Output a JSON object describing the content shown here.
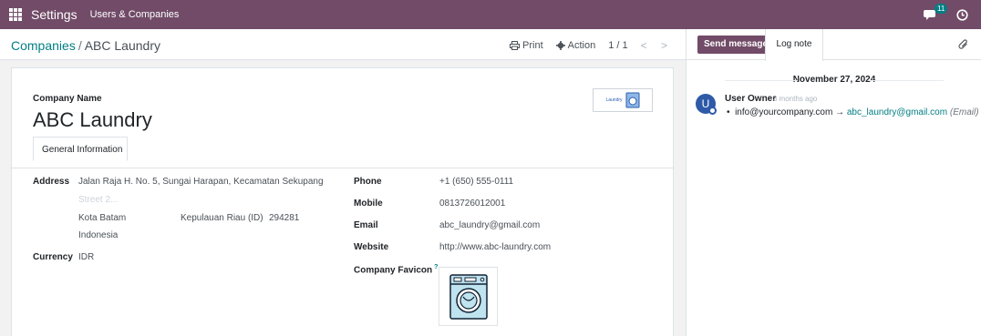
{
  "navbar": {
    "app_title": "Settings",
    "menu_users": "Users & Companies",
    "message_count": "11",
    "icons": [
      "apps-icon",
      "chat-icon",
      "clock-icon"
    ]
  },
  "control_panel": {
    "breadcrumb_parent": "Companies",
    "breadcrumb_sep": "/",
    "breadcrumb_current": "ABC Laundry",
    "print_label": "Print",
    "action_label": "Action",
    "pager_value": "1 / 1",
    "pager_arrows": "< >"
  },
  "form": {
    "company_name_label": "Company Name",
    "company_name": "ABC Laundry",
    "logo_text": "Laundry",
    "tab_general": "General Information",
    "address_label": "Address",
    "street": "Jalan Raja H. No. 5, Sungai Harapan, Kecamatan Sekupang",
    "street2_placeholder": "Street 2...",
    "city": "Kota Batam",
    "state": "Kepulauan Riau (ID)",
    "zip": "294281",
    "country": "Indonesia",
    "currency_label": "Currency",
    "currency": "IDR",
    "phone_label": "Phone",
    "phone": "+1 (650) 555-0111",
    "mobile_label": "Mobile",
    "mobile": "0813726012001",
    "email_label": "Email",
    "email": "abc_laundry@gmail.com",
    "website_label": "Website",
    "website": "http://www.abc-laundry.com",
    "favicon_label": "Company Favicon",
    "favicon_help": "?"
  },
  "chatter": {
    "send_message": "Send message",
    "log_note": "Log note",
    "date": "November 27, 2024",
    "avatar_letter": "U",
    "author": "User Owner",
    "time_ago": "- 3 months ago",
    "old_value": "info@yourcompany.com",
    "arrow": "→",
    "new_value": "abc_laundry@gmail.com",
    "field_name": "(Email)"
  },
  "colors": {
    "brand": "#714b67",
    "link": "#017e84",
    "avatar": "#2e5aa8"
  }
}
